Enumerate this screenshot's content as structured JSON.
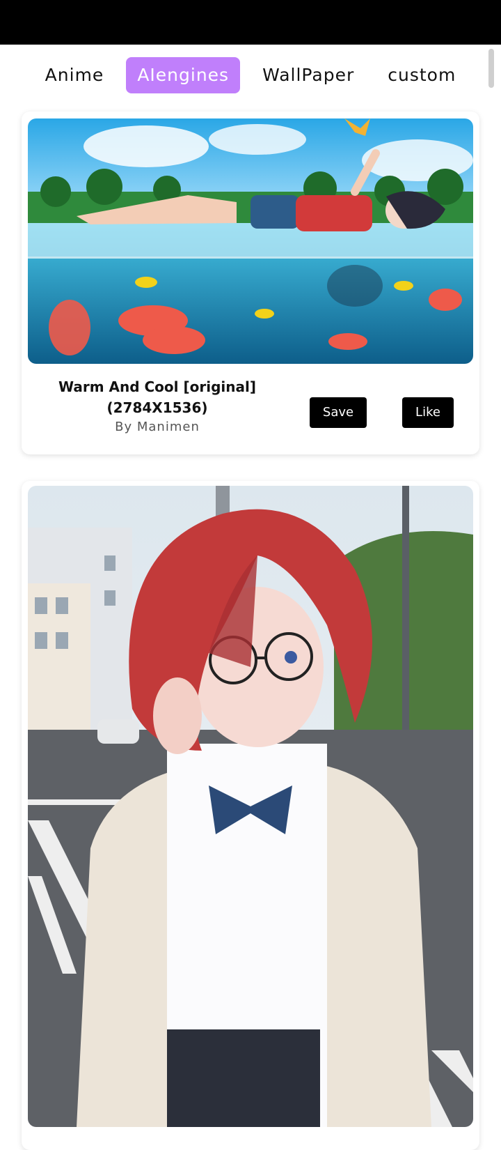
{
  "tabs": [
    {
      "label": "Anime",
      "active": false
    },
    {
      "label": "AIengines",
      "active": true
    },
    {
      "label": "WallPaper",
      "active": false
    },
    {
      "label": "custom",
      "active": false
    }
  ],
  "accent": "#c07ffb",
  "cards": [
    {
      "title": "Warm And Cool [original] (2784X1536)",
      "author": "By Manimen",
      "save_label": "Save",
      "like_label": "Like"
    }
  ]
}
